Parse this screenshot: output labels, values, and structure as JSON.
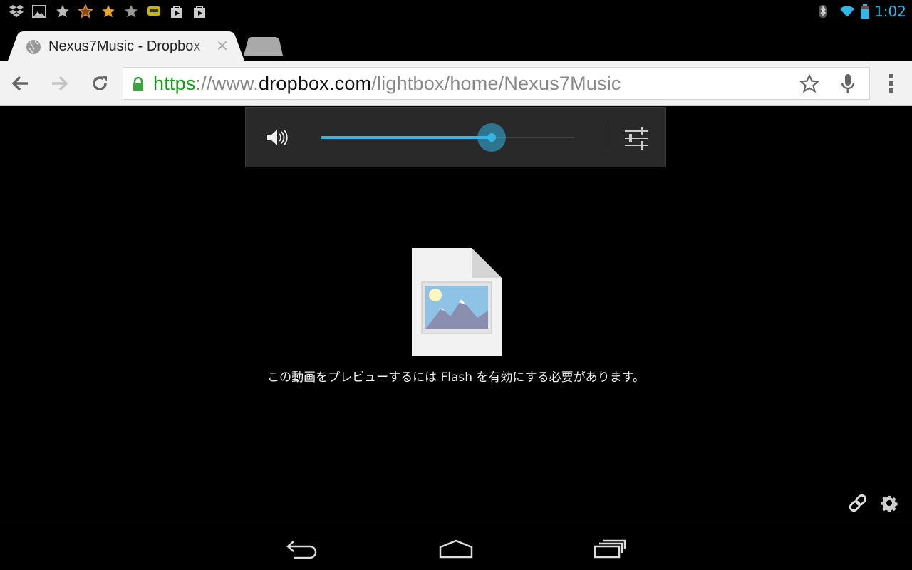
{
  "status_bar": {
    "notification_icons": [
      "dropbox-icon",
      "image-icon",
      "star-gray-icon",
      "star-orange-outline-icon",
      "star-orange-icon",
      "star-gray-icon",
      "talk-icon",
      "play-store-icon",
      "play-store-icon"
    ],
    "system_icons": [
      "bluetooth-icon",
      "wifi-icon",
      "battery-icon"
    ],
    "clock": "1:02",
    "accent_color": "#33b5e5"
  },
  "browser": {
    "active_tab": {
      "title": "Nexus7Music - Dropbox",
      "close_label": "×",
      "favicon": "globe-icon"
    },
    "url": {
      "scheme": "https",
      "separator": "://",
      "subdomain": "www.",
      "host": "dropbox.com",
      "path": "/lightbox/home/Nexus7Music"
    },
    "toolbar_icons": [
      "back-icon",
      "forward-icon",
      "reload-icon",
      "lock-icon",
      "bookmark-star-icon",
      "microphone-icon",
      "menu-icon"
    ]
  },
  "volume": {
    "level": 0.67,
    "icons": [
      "speaker-icon",
      "equalizer-icon"
    ]
  },
  "content": {
    "preview_icon": "image-file-icon",
    "message": "この動画をプレビューするには Flash を有効にする必要があります。",
    "actions": [
      "link-icon",
      "settings-icon"
    ]
  },
  "navigation": {
    "buttons": [
      "back-nav-icon",
      "home-nav-icon",
      "recent-apps-icon"
    ]
  }
}
